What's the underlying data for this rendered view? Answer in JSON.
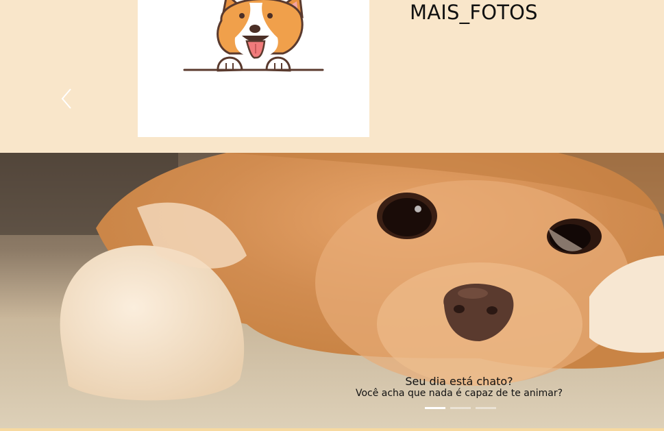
{
  "header": {
    "link_label": "MAIS_FOTOS",
    "logo_icon": "corgi-cartoon-logo",
    "prev_icon": "chevron-left-icon"
  },
  "carousel": {
    "caption_title": "Seu dia está chato?",
    "caption_subtitle": "Você acha que nada é capaz de te animar?",
    "slide_count": 3,
    "active_slide": 1,
    "image": "pomeranian-dog-lying-on-carpet"
  },
  "colors": {
    "page_background": "#f9e6ca",
    "caption_text": "#111111",
    "indicator_active": "#ffffff"
  }
}
